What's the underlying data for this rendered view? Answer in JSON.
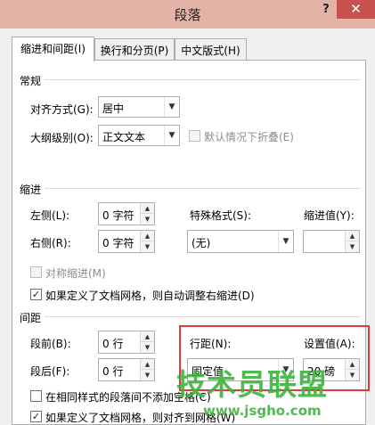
{
  "window": {
    "title": "段落",
    "help": "?",
    "close": "✕"
  },
  "tabs": [
    "缩进和间距(I)",
    "换行和分页(P)",
    "中文版式(H)"
  ],
  "general": {
    "section_label": "常规",
    "alignment_label": "对齐方式(G):",
    "alignment_value": "居中",
    "outline_label": "大纲级别(O):",
    "outline_value": "正文文本",
    "collapse_label": "默认情况下折叠(E)"
  },
  "indent": {
    "section_label": "缩进",
    "left_label": "左侧(L):",
    "left_value": "0 字符",
    "right_label": "右侧(R):",
    "right_value": "0 字符",
    "special_label": "特殊格式(S):",
    "special_value": "(无)",
    "by_label": "缩进值(Y):",
    "by_value": "",
    "mirror_label": "对称缩进(M)",
    "auto_adjust_label": "如果定义了文档网格，则自动调整右缩进(D)"
  },
  "spacing": {
    "section_label": "间距",
    "before_label": "段前(B):",
    "before_value": "0 行",
    "after_label": "段后(F):",
    "after_value": "0 行",
    "line_spacing_label": "行距(N):",
    "line_spacing_value": "固定值",
    "at_label": "设置值(A):",
    "at_value": "20 磅",
    "no_space_label": "在相同样式的段落间不添加空格(C)",
    "snap_grid_label": "如果定义了文档网格，则对齐到网格(W)"
  },
  "watermark": {
    "main": "技术员联盟",
    "url": "www.jsgho.com"
  },
  "colors": {
    "highlight": "#e23b3b",
    "watermark": "#3cb43c",
    "title_bar": "#e3b4a6",
    "close": "#c75050"
  }
}
